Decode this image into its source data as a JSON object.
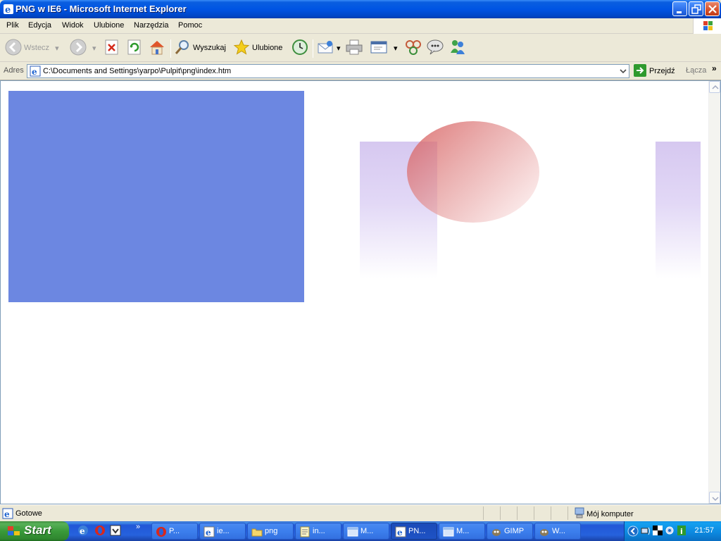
{
  "window": {
    "title": "PNG w IE6 - Microsoft Internet Explorer"
  },
  "menu": [
    "Plik",
    "Edycja",
    "Widok",
    "Ulubione",
    "Narzędzia",
    "Pomoc"
  ],
  "toolbar": {
    "back_label": "Wstecz",
    "search_label": "Wyszukaj",
    "favorites_label": "Ulubione"
  },
  "address": {
    "label": "Adres",
    "value": "C:\\Documents and Settings\\yarpo\\Pulpit\\png\\index.htm",
    "go_label": "Przejdź",
    "links_label": "Łącza"
  },
  "status": {
    "text": "Gotowe",
    "zone": "Mój komputer"
  },
  "taskbar": {
    "start_label": "Start",
    "tasks": [
      "P...",
      "ie...",
      "png",
      "in...",
      "M...",
      "PN...",
      "M...",
      "GIMP",
      "W..."
    ],
    "clock": "21:57"
  },
  "colors": {
    "blue_rect": "#6C87E1",
    "purple_tint": "#D6C8F0",
    "ellipse_red": "#D65858"
  }
}
